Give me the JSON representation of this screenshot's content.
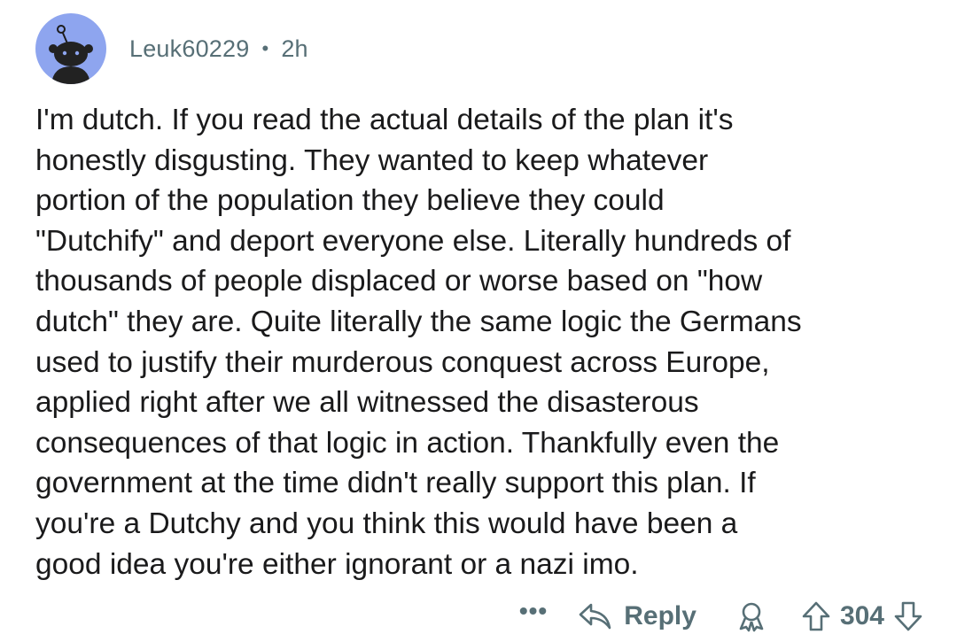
{
  "comment": {
    "author": "Leuk60229",
    "separator": "•",
    "time_ago": "2h",
    "body": "I'm dutch. If you read the actual details of the plan it's\nhonestly disgusting. They wanted to keep whatever\nportion of the population they believe they could\n\"Dutchify\" and deport everyone else. Literally hundreds of\nthousands of people displaced or worse based on \"how\ndutch\" they are. Quite literally the same logic the Germans\nused to justify their murderous conquest across Europe,\napplied right after we all witnessed the disasterous\nconsequences of that logic in action. Thankfully even the\ngovernment at the time didn't really support this plan. If\nyou're a Dutchy and you think this would have been a\ngood idea you're either ignorant or a nazi imo."
  },
  "actions": {
    "more_label": "•••",
    "reply_label": "Reply",
    "score": "304"
  },
  "icons": {
    "avatar": "reddit-snoo-avatar-icon",
    "reply": "reply-arrow-icon",
    "award": "award-icon",
    "upvote": "upvote-arrow-icon",
    "downvote": "downvote-arrow-icon"
  },
  "colors": {
    "avatar_bg": "#8ea5ef",
    "meta_text": "#576f76",
    "body_text": "#1a1a1b"
  }
}
